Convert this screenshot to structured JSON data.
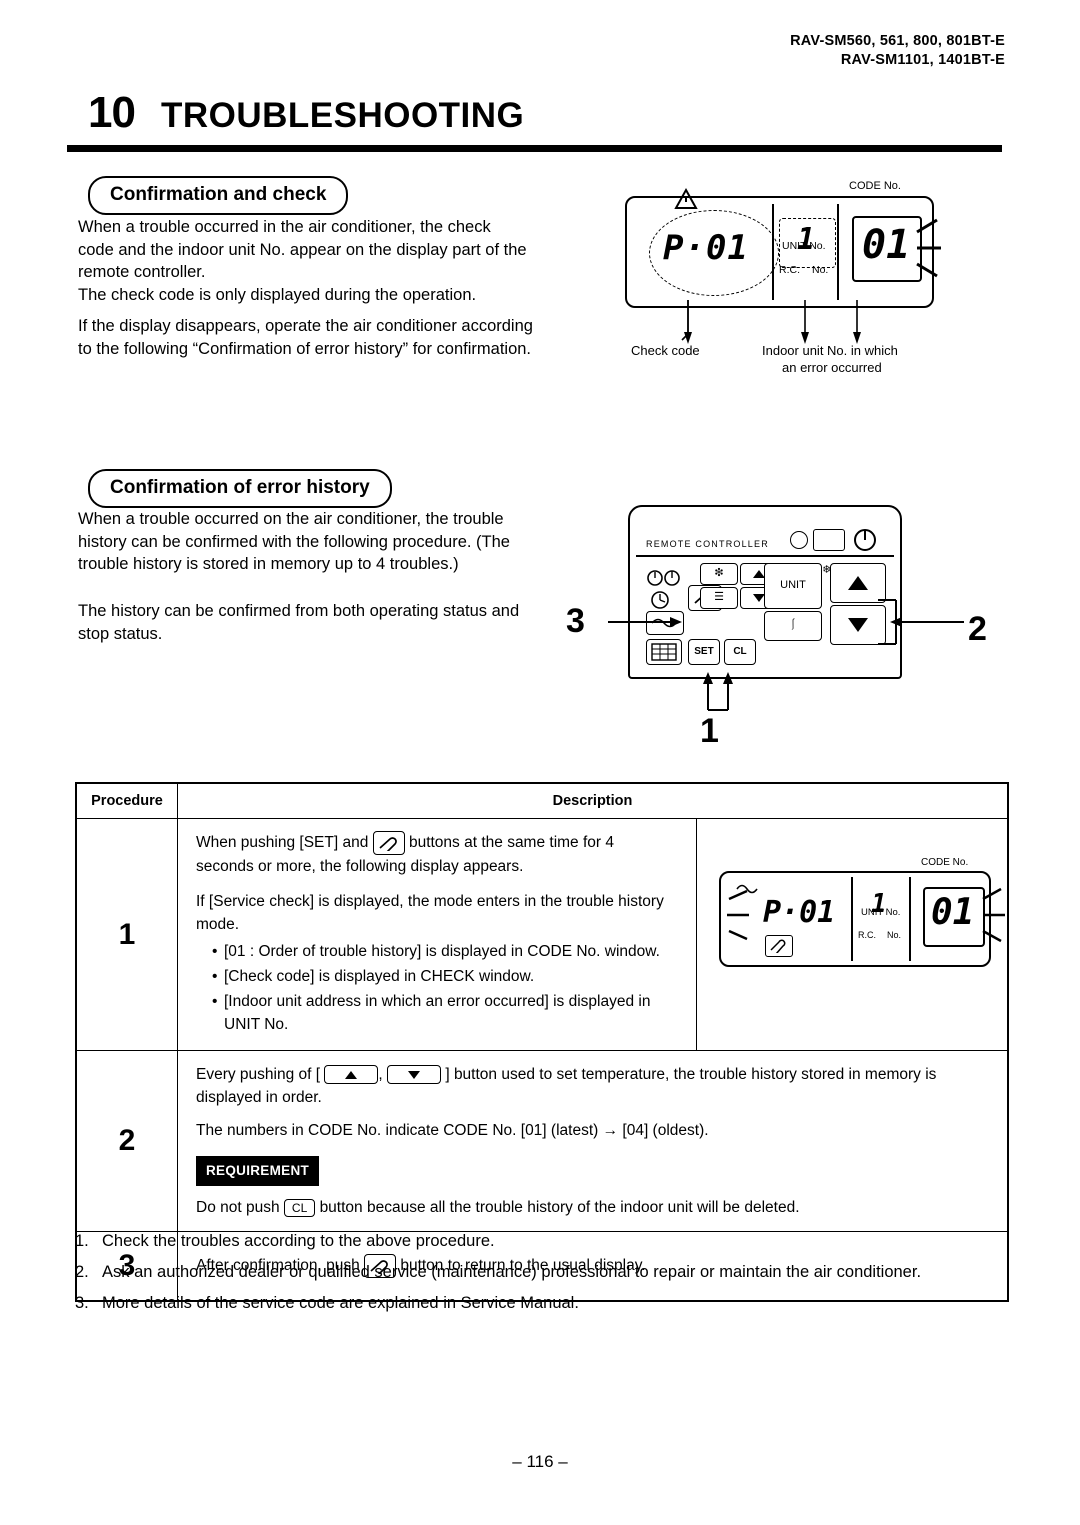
{
  "header": {
    "models_line1": "RAV-SM560, 561, 800, 801BT-E",
    "models_line2": "RAV-SM1101, 1401BT-E",
    "chapter_number": "10",
    "chapter_title": "TROUBLESHOOTING"
  },
  "section1": {
    "heading": "Confirmation and check",
    "p1": "When a trouble occurred in the air conditioner, the check code and the indoor unit No. appear on the display part of the remote controller.",
    "p2": "The check code is only displayed during the operation.",
    "p3": "If the display disappears, operate the air conditioner according to the following “Confirmation of error history” for confirmation.",
    "display": {
      "code_no_label": "CODE No.",
      "unit_no_label": "UNIT No.",
      "rc_label": "R.C.",
      "no_label": "No.",
      "check_code_value": "P·01",
      "unit_value": "1",
      "code_value": "01"
    },
    "caption_left": "Check code",
    "caption_right_line1": "Indoor unit No. in which",
    "caption_right_line2": "an error occurred"
  },
  "section2": {
    "heading": "Confirmation of error history",
    "p1": "When a trouble occurred on the air conditioner, the trouble history can be confirmed with the following procedure. (The trouble history is stored in memory up to 4 troubles.)",
    "p2": "The history can be confirmed from both operating status and stop status.",
    "remote": {
      "title": "REMOTE CONTROLLER",
      "unit_label": "UNIT",
      "set_label": "SET",
      "cl_label": "CL"
    },
    "callouts": {
      "one": "1",
      "two": "2",
      "three": "3"
    }
  },
  "table": {
    "header_procedure": "Procedure",
    "header_description": "Description",
    "rows": [
      {
        "num": "1",
        "text1_a": "When pushing [SET] and",
        "text1_b": "buttons at the same time for 4",
        "text1_c": "seconds or more, the following display appears.",
        "text2": "If [Service check] is displayed, the mode enters in the trouble history mode.",
        "bullets": [
          "[01 : Order of trouble history] is displayed in CODE No. window.",
          "[Check code] is displayed in CHECK window.",
          "[Indoor unit address in which an error occurred] is displayed in UNIT No."
        ],
        "display": {
          "code_no_label": "CODE No.",
          "unit_no_label": "UNIT No.",
          "rc_label": "R.C.",
          "no_label": "No.",
          "check_code_value": "P·01",
          "unit_value": "1",
          "code_value": "01"
        }
      },
      {
        "num": "2",
        "text1_a": "Every pushing of [",
        "text1_b": ",",
        "text1_c": "] button used to set temperature, the trouble history stored in memory is",
        "text1_d": "displayed in order.",
        "text2": "The numbers in CODE No. indicate CODE No.  [01] (latest) → [04] (oldest).",
        "requirement_badge": "REQUIREMENT",
        "req_a": "Do not push",
        "req_key": "CL",
        "req_b": "button because all the trouble history of the indoor unit will be deleted."
      },
      {
        "num": "3",
        "text1_a": "After confirmation, push",
        "text1_b": "button to return to the usual display."
      }
    ]
  },
  "footer_notes": [
    {
      "n": "1.",
      "t": "Check the troubles according to the above procedure."
    },
    {
      "n": "2.",
      "t": "Ask an authorized dealer or qualified service (maintenance) professional to repair or maintain the air conditioner."
    },
    {
      "n": "3.",
      "t": "More details of the service code are explained in Service Manual."
    }
  ],
  "page_number": "– 116 –"
}
